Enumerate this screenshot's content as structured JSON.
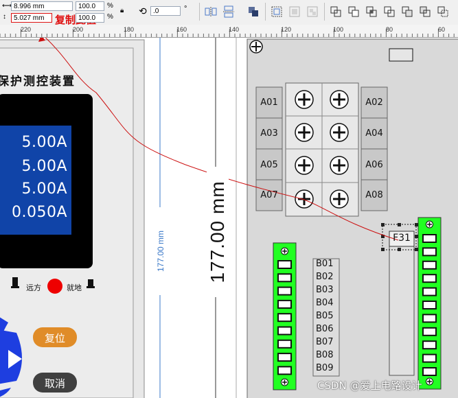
{
  "toolbar": {
    "width_value": "8.996 mm",
    "height_value": "5.027 mm",
    "scale_x": "100.0",
    "scale_y": "100.0",
    "percent_symbol": "%",
    "rotation_value": ".0",
    "degree_symbol": "°",
    "annotation": "复制此值"
  },
  "ruler": {
    "labels": [
      "220",
      "200",
      "180",
      "160",
      "140",
      "120",
      "100",
      "80",
      "60"
    ]
  },
  "device": {
    "title": "保护测控装置",
    "lcd_lines": [
      "5.00A",
      "5.00A",
      "5.00A",
      "0.050A"
    ],
    "remote_label": "远方",
    "local_label": "就地",
    "reset_button": "复位",
    "cancel_button": "取消"
  },
  "dimension": {
    "small": "177.00 mm",
    "large": "177.00 mm"
  },
  "terminal_labels_a": [
    "A01",
    "A02",
    "A03",
    "A04",
    "A05",
    "A06",
    "A07",
    "A08"
  ],
  "terminal_labels_b": [
    "B01",
    "B02",
    "B03",
    "B04",
    "B05",
    "B06",
    "B07",
    "B08",
    "B09"
  ],
  "selected_label": "F31",
  "watermark": "CSDN @爱上电路设计",
  "colors": {
    "lcd_blue": "#1044a8",
    "terminal_green": "#22ff22",
    "reset_orange": "#e08c28",
    "cancel_dark": "#404040",
    "annotation_red": "#e01010",
    "button_blue": "#1e3ee0"
  }
}
